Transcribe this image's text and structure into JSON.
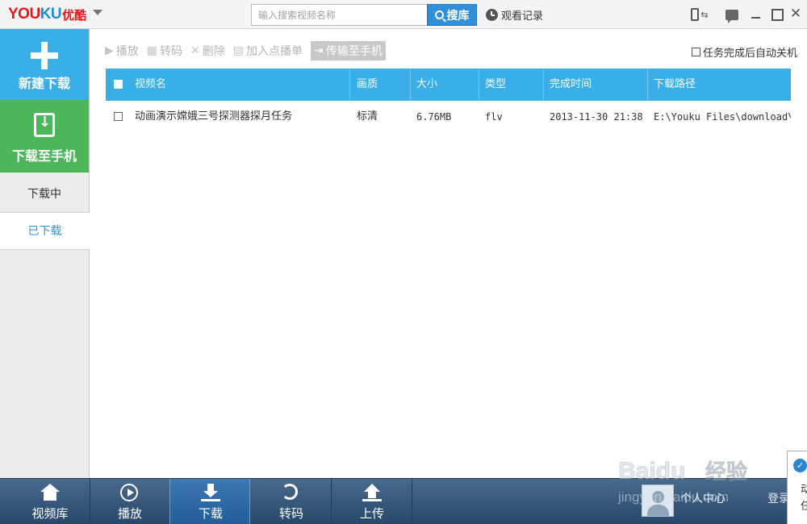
{
  "app": {
    "logo_text": "YOUKU",
    "logo_cn": "优酷"
  },
  "search": {
    "placeholder": "输入搜索视频名称",
    "button_label": "搜库"
  },
  "titlebar": {
    "history_label": "观看记录"
  },
  "sidebar": {
    "new_download": "新建下载",
    "download_to_phone": "下载至手机",
    "downloading": "下载中",
    "downloaded": "已下载"
  },
  "toolbar": {
    "play": "播放",
    "transcode": "转码",
    "delete": "删除",
    "add_to_playlist": "加入点播单",
    "transfer_to_phone": "传输至手机",
    "auto_shutdown": "任务完成后自动关机"
  },
  "table": {
    "headers": [
      "视频名",
      "画质",
      "大小",
      "类型",
      "完成时间",
      "下载路径"
    ],
    "rows": [
      {
        "name": "动画演示嫦娥三号探测器探月任务",
        "quality": "标清",
        "size": "6.76MB",
        "type": "flv",
        "time": "2013-11-30 21:38",
        "path": "E:\\Youku Files\\download\\"
      }
    ]
  },
  "bottom_tabs": [
    "视频库",
    "播放",
    "下载",
    "转码",
    "上传"
  ],
  "user": {
    "center": "个人中心",
    "login": "登录"
  },
  "popup": {
    "line1": "动",
    "line2": "任"
  },
  "watermark": {
    "brand": "Baidu",
    "cn": "经验",
    "url": "jingyan.baidu.com"
  },
  "colors": {
    "accent_blue": "#3aaee7",
    "green": "#4db55a",
    "bottom_bar": "#27486b"
  }
}
